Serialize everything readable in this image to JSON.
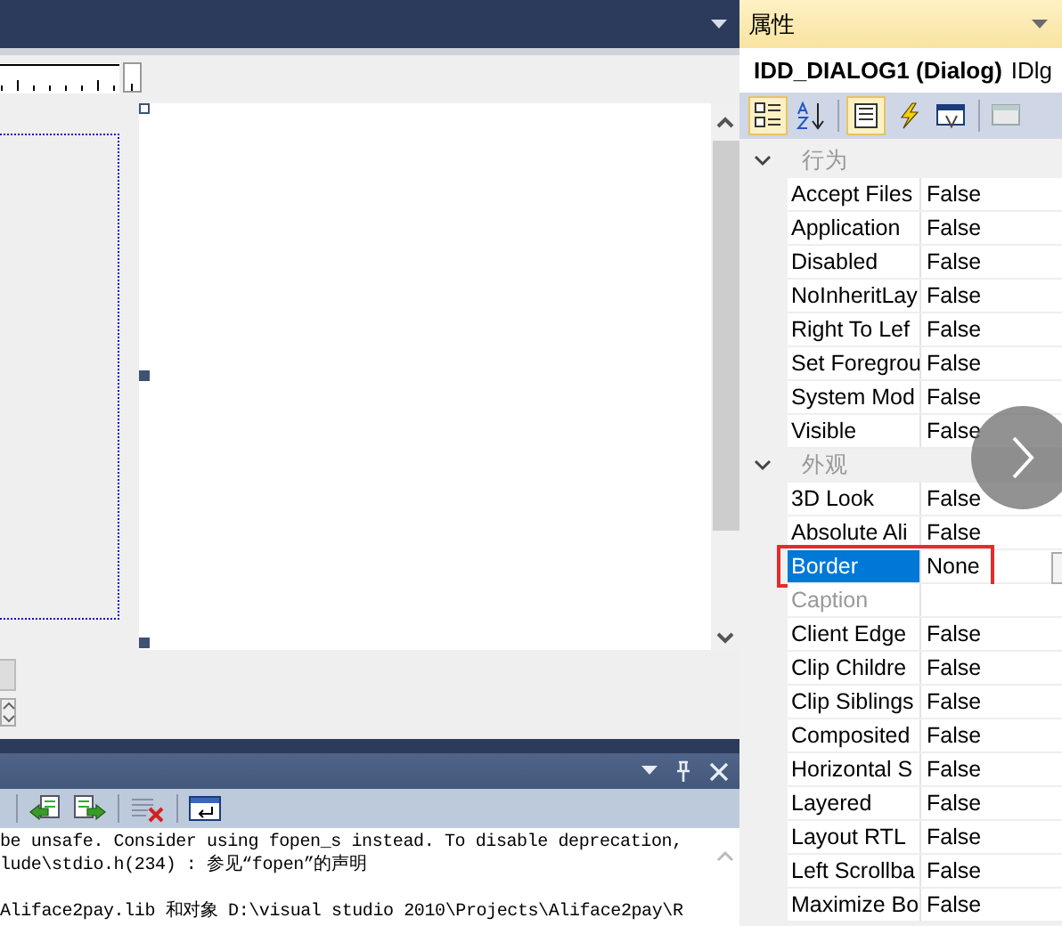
{
  "properties_panel": {
    "title": "属性",
    "object_name": "IDD_DIALOG1 (Dialog)",
    "object_class": "IDlg",
    "toolbar": [
      {
        "kind": "categorized",
        "selected": true
      },
      {
        "kind": "alphabetical",
        "selected": false
      },
      {
        "kind": "properties",
        "selected": true
      },
      {
        "kind": "events",
        "selected": false
      },
      {
        "kind": "messages",
        "selected": false
      },
      {
        "kind": "overrides",
        "selected": false
      }
    ],
    "categories": [
      {
        "name": "行为",
        "expanded": true,
        "properties": [
          {
            "name": "Accept Files",
            "value": "False",
            "selected": false,
            "disabled": false,
            "highlighted": false
          },
          {
            "name": "Application",
            "value": "False",
            "selected": false,
            "disabled": false,
            "highlighted": false
          },
          {
            "name": "Disabled",
            "value": "False",
            "selected": false,
            "disabled": false,
            "highlighted": false
          },
          {
            "name": "NoInheritLay",
            "value": "False",
            "selected": false,
            "disabled": false,
            "highlighted": false
          },
          {
            "name": "Right To Lef",
            "value": "False",
            "selected": false,
            "disabled": false,
            "highlighted": false
          },
          {
            "name": "Set Foregrou",
            "value": "False",
            "selected": false,
            "disabled": false,
            "highlighted": false
          },
          {
            "name": "System Mod",
            "value": "False",
            "selected": false,
            "disabled": false,
            "highlighted": false
          },
          {
            "name": "Visible",
            "value": "False",
            "selected": false,
            "disabled": false,
            "highlighted": false
          }
        ]
      },
      {
        "name": "外观",
        "expanded": true,
        "properties": [
          {
            "name": "3D Look",
            "value": "False",
            "selected": false,
            "disabled": false,
            "highlighted": false
          },
          {
            "name": "Absolute Ali",
            "value": "False",
            "selected": false,
            "disabled": false,
            "highlighted": false
          },
          {
            "name": "Border",
            "value": "None",
            "selected": true,
            "disabled": false,
            "highlighted": true
          },
          {
            "name": "Caption",
            "selected": false,
            "disabled": true,
            "highlighted": false
          },
          {
            "name": "Client Edge",
            "value": "False",
            "selected": false,
            "disabled": false,
            "highlighted": false
          },
          {
            "name": "Clip Childre",
            "value": "False",
            "selected": false,
            "disabled": false,
            "highlighted": false
          },
          {
            "name": "Clip Siblings",
            "value": "False",
            "selected": false,
            "disabled": false,
            "highlighted": false
          },
          {
            "name": "Composited",
            "value": "False",
            "selected": false,
            "disabled": false,
            "highlighted": false
          },
          {
            "name": "Horizontal S",
            "value": "False",
            "selected": false,
            "disabled": false,
            "highlighted": false
          },
          {
            "name": "Layered",
            "value": "False",
            "selected": false,
            "disabled": false,
            "highlighted": false
          },
          {
            "name": "Layout RTL",
            "value": "False",
            "selected": false,
            "disabled": false,
            "highlighted": false
          },
          {
            "name": "Left Scrollba",
            "value": "False",
            "selected": false,
            "disabled": false,
            "highlighted": false
          },
          {
            "name": "Maximize Bo",
            "value": "False",
            "selected": false,
            "disabled": false,
            "highlighted": false
          }
        ]
      }
    ]
  },
  "output_panel": {
    "toolbar": [
      {
        "kind": "previous"
      },
      {
        "kind": "next"
      },
      {
        "kind": "clear"
      },
      {
        "kind": "wrap"
      }
    ],
    "lines": [
      "be unsafe. Consider using fopen_s instead. To disable deprecation,",
      "lude\\stdio.h(234) : 参见“fopen”的声明",
      "Aliface2pay.lib 和对象 D:\\visual studio 2010\\Projects\\Aliface2pay\\R"
    ]
  }
}
